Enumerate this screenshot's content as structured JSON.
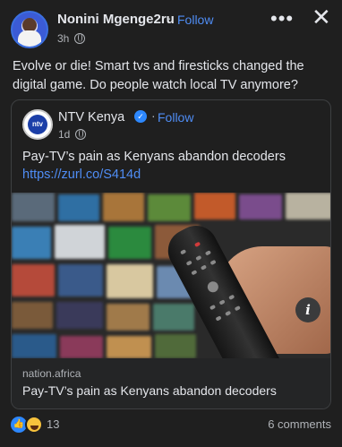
{
  "post": {
    "author": "Nonini Mgenge2ru",
    "follow_label": "Follow",
    "separator": "·",
    "time": "3h",
    "more_glyph": "•••",
    "close_glyph": "✕",
    "text": "Evolve or die! Smart tvs and firesticks changed the digital game. Do people watch local TV anymore?"
  },
  "shared": {
    "page_name": "NTV Kenya",
    "logo_text": "ntv",
    "follow_label": "Follow",
    "separator": "·",
    "time": "1d",
    "text": "Pay-TV’s pain as Kenyans abandon decoders",
    "link": "https://zurl.co/S414d",
    "info_glyph": "i",
    "domain": "nation.africa",
    "link_title": "Pay-TV’s pain as Kenyans abandon decoders"
  },
  "reactions": {
    "count": "13",
    "comments": "6 comments",
    "icons": [
      "like-icon",
      "haha-icon"
    ]
  },
  "colors": {
    "accent": "#4f8df5",
    "background": "#1f1f1f",
    "text": "#e4e6eb",
    "muted": "#b0b3b8"
  }
}
